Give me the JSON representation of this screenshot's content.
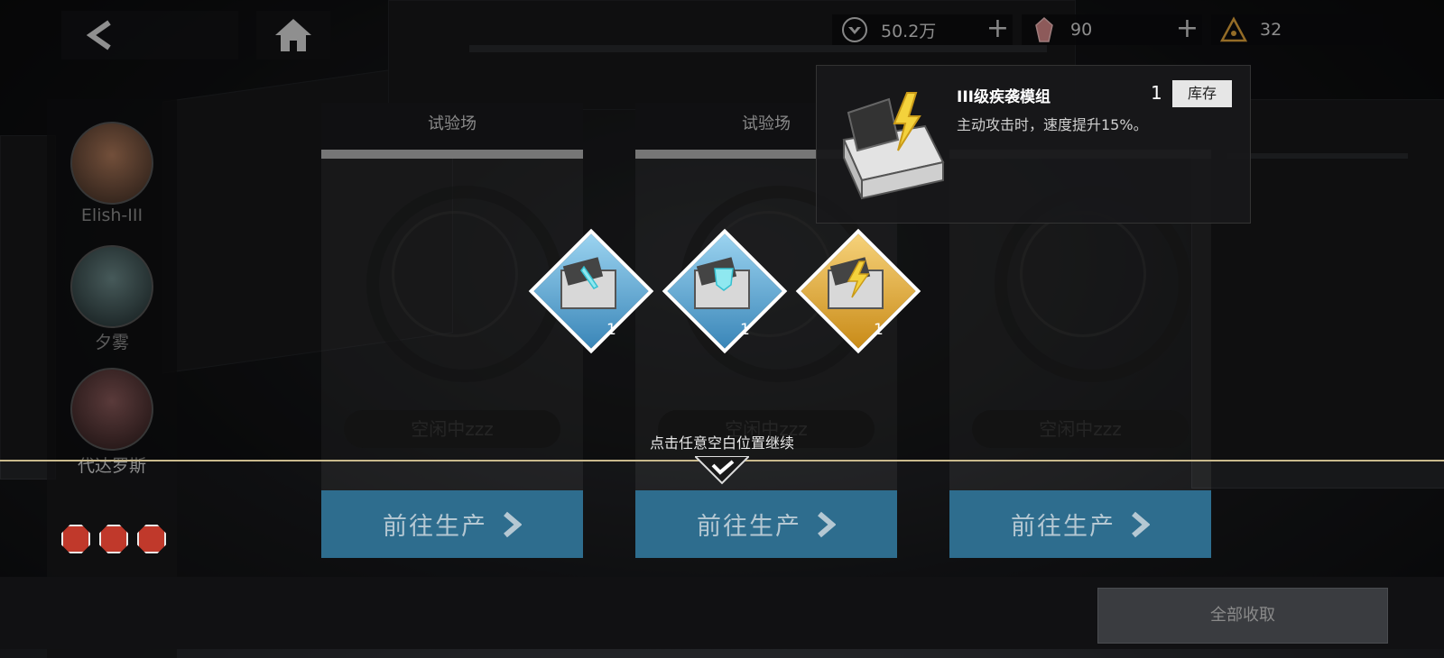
{
  "resources": [
    {
      "icon": "crest-emblem-icon",
      "value": "50.2万",
      "has_plus": true
    },
    {
      "icon": "red-crystal-icon",
      "value": "90",
      "has_plus": true
    },
    {
      "icon": "triangle-badge-icon",
      "value": "32",
      "has_plus": false
    }
  ],
  "characters": [
    {
      "name": "Elish-III"
    },
    {
      "name": "夕雾"
    },
    {
      "name": "代达罗斯"
    }
  ],
  "panels": [
    {
      "title": "试验场",
      "status": "空闲中zzz",
      "go_label": "前往生产"
    },
    {
      "title": "试验场",
      "status": "空闲中zzz",
      "go_label": "前往生产"
    },
    {
      "title": "",
      "status": "空闲中zzz",
      "go_label": "前往生产"
    }
  ],
  "rewards": [
    {
      "icon": "blue-sword-module-icon",
      "count": "1",
      "frame_color": "#6fb6e0"
    },
    {
      "icon": "blue-armor-module-icon",
      "count": "1",
      "frame_color": "#6fb6e0"
    },
    {
      "icon": "gold-lightning-module-icon",
      "count": "1",
      "frame_color": "#e8b23a"
    }
  ],
  "continue_hint": "点击任意空白位置继续",
  "tooltip": {
    "name": "III级疾袭模组",
    "quantity": "1",
    "stock_label": "库存",
    "description": "主动攻击时，速度提升15%。"
  },
  "collect_all_label": "全部收取"
}
